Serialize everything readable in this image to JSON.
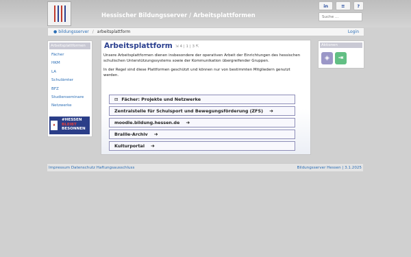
{
  "header": {
    "site_title": "Hessischer Bildungsserver / Arbeitsplattformen",
    "tools": {
      "linkedin": "in",
      "menu": "≡",
      "help": "?"
    },
    "search_placeholder": "Suche ..."
  },
  "breadcrumb": {
    "items": [
      "bildungsserver",
      "arbeitsplattform"
    ],
    "login": "Login"
  },
  "sidebar": {
    "title": "Arbeitsplattformen",
    "items": [
      "Fächer",
      "HKM",
      "LA",
      "Schulämter",
      "BFZ",
      "Studienseminare",
      "Netzwerke"
    ],
    "badge_lines": [
      "#HESSEN",
      "BLEIBT",
      "BESONNEN"
    ]
  },
  "main": {
    "title": "Arbeitsplattform",
    "pager": "⇲ 4 | 1 | 3 ⇱",
    "intro1": "Unsere Arbeitsplattformen dienen insbesondere der operativen Arbeit der Einrichtungen des hessischen schulischen Unterstützungssystems sowie der Kommunikation übergreifender Gruppen.",
    "intro2": "In der Regel sind diese Plattformen geschützt und können nur von bestimmten Mitgliedern genutzt werden.",
    "platforms": [
      "Fächer: Projekte und Netzwerke",
      "Zentralstelle für Schulsport und Bewegungsförderung (ZFS)",
      "moodle.bildung.hessen.de",
      "Braille-Archiv",
      "Kulturportal"
    ]
  },
  "aktionen": {
    "title": "Aktionen"
  },
  "footer": {
    "links": "Impressum Datenschutz Haftungsausschluss",
    "right": "Bildungsserver Hessen | 3.1.2025"
  },
  "colors": {
    "accent": "#2a3f8f",
    "link": "#2a6db5",
    "badge": "#2b3e88"
  }
}
